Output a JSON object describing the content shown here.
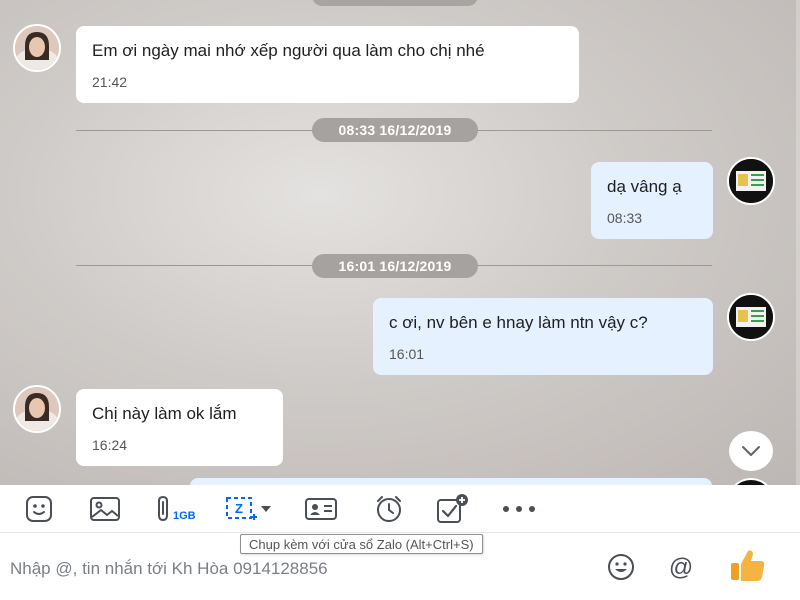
{
  "dividers": [
    {
      "label": "08:33 16/12/2019"
    },
    {
      "label": "16:01 16/12/2019"
    }
  ],
  "messages": [
    {
      "direction": "incoming",
      "text": "Em ơi ngày mai nhớ xếp người qua làm cho chị nhé",
      "time": "21:42"
    },
    {
      "direction": "outgoing",
      "text": "dạ vâng ạ",
      "time": "08:33"
    },
    {
      "direction": "outgoing",
      "text": "c ơi, nv bên e hnay làm ntn vậy c?",
      "time": "16:01"
    },
    {
      "direction": "incoming",
      "text": "Chị này làm ok lắm",
      "time": "16:24"
    }
  ],
  "toolbar": {
    "attach_size_badge": "1GB",
    "screenshot_tooltip": "Chụp kèm với cửa sổ Zalo (Alt+Ctrl+S)"
  },
  "composer": {
    "placeholder": "Nhập @, tin nhắn tới Kh Hòa 0914128856"
  },
  "colors": {
    "accent": "#0068ff",
    "outgoing_bubble": "#e5f1ff",
    "incoming_bubble": "#ffffff",
    "like": "#f5a623"
  },
  "icons": [
    "sticker-icon",
    "image-icon",
    "paperclip-icon",
    "screenshot-icon",
    "chevron-down-icon",
    "contact-card-icon",
    "reminder-clock-icon",
    "todo-icon",
    "more-icon",
    "emoji-icon",
    "mention-icon",
    "thumbs-up-icon"
  ]
}
